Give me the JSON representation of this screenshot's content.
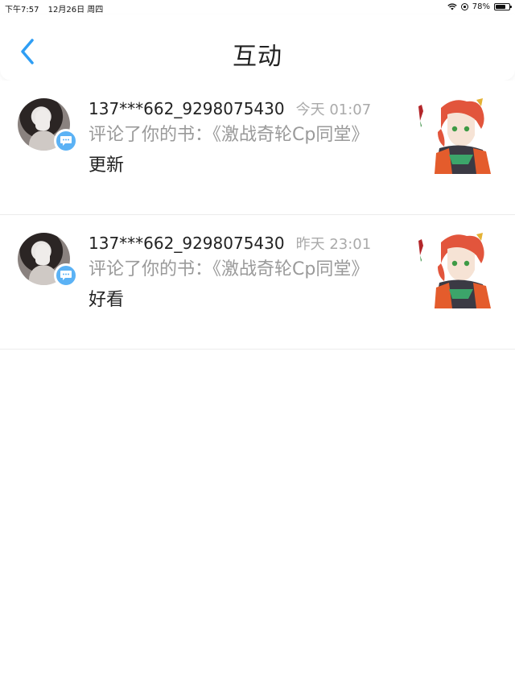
{
  "status_bar": {
    "time": "下午7:57",
    "date": "12月26日 周四",
    "battery_percent": "78%",
    "battery_level": 0.78,
    "icons": [
      "wifi-icon",
      "orientation-lock-icon",
      "battery-icon"
    ]
  },
  "nav": {
    "title": "互动",
    "back_icon": "chevron-left-icon",
    "accent_color": "#2f9ef4"
  },
  "interactions": [
    {
      "username": "137***662_9298075430",
      "time": "今天 01:07",
      "description": "评论了你的书：《激战奇轮Cp同堂》",
      "comment": "更新",
      "badge_icon": "comment-icon",
      "thumbnail": "book-cover-anime-character"
    },
    {
      "username": "137***662_9298075430",
      "time": "昨天 23:01",
      "description": "评论了你的书：《激战奇轮Cp同堂》",
      "comment": "好看",
      "badge_icon": "comment-icon",
      "thumbnail": "book-cover-anime-character"
    }
  ]
}
